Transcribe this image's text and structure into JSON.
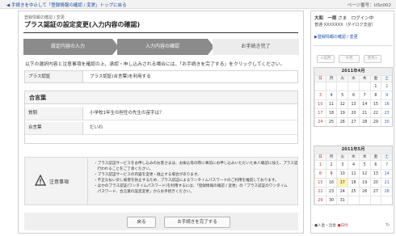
{
  "topbar": {
    "back_link": "◀ 手続きを中止して「登録情報の確認 / 変更」トップに戻る",
    "page_number": "ページ番号：USo002"
  },
  "main": {
    "breadcrumb": "登録情報の確認 / 変更",
    "title": "プラス認証の設定変更(入力内容の確認)",
    "steps": [
      "設定内容の入力",
      "入力内容の確認",
      "お手続き完了"
    ],
    "intro": "以下の選択内容と注意事項を確認の上、承認・申し込みされる場合には、「お手続きを完了する」をクリックしてください。",
    "summary": {
      "label": "プラス認証",
      "value": "プラス認証(合言葉)を利用する"
    },
    "passphrase": {
      "heading": "合言葉",
      "rows": [
        {
          "label": "質問",
          "value": "小学校1年生の担任の先生の苗字は？"
        },
        {
          "label": "合言葉",
          "value": "だいわ"
        }
      ]
    },
    "notice": {
      "label": "注意事項",
      "items": [
        "・プラス認証サービスをお申し込みのお客さまは、お振込等の際に事前にお申し込みいただいた本人確認に加え、プラス認証による本人確認が",
        "　行われることをご了承ください。",
        "・プラス認証サービスの内容を変更・廃止する場合があります。",
        "・不正な払い戻し被害を防止するため、プラス認証によるワンタイムパスワードのご利用を推奨しております。",
        "・ほかのプラス認証(ワンタイムパスワード)を利用するには、「登録情報の確認 / 変更」の「プラス認証のワンタイム",
        "　パスワード、合言葉の設定変更」からお手続きください。"
      ]
    },
    "buttons": {
      "back": "戻る",
      "complete": "お手続きを完了する"
    }
  },
  "side": {
    "user_name": "大和　一郎",
    "user_suffix": " さま　ログイン中",
    "account": "普通 XXXXXXX（ダイロク支店）",
    "link": "▶登録情報の確認 / 変更",
    "nav": {
      "prev": "<前月",
      "today": "今月",
      "next": "翌月>"
    },
    "weekdays": [
      "日",
      "月",
      "火",
      "水",
      "木",
      "金",
      "土"
    ],
    "calendars": [
      {
        "title": "2011年4月",
        "days": [
          "",
          "",
          "",
          "",
          "",
          "1",
          "2",
          "3",
          "4",
          "5",
          "6",
          "7",
          "8",
          "9",
          "10",
          "11",
          "12",
          "13",
          "14",
          "15",
          "16",
          "17",
          "18",
          "19",
          "20",
          "21",
          "22",
          "23",
          "24",
          "25",
          "26",
          "27",
          "28",
          "29",
          "30"
        ]
      },
      {
        "title": "2011年5月",
        "days": [
          "1",
          "2",
          "3",
          "4",
          "5",
          "6",
          "7",
          "8",
          "9",
          "10",
          "11",
          "12",
          "13",
          "14",
          "15",
          "16",
          "17",
          "18",
          "19",
          "20",
          "21",
          "22",
          "23",
          "24",
          "25",
          "26",
          "27",
          "28",
          "29",
          "30",
          "31",
          "",
          "",
          "",
          ""
        ]
      }
    ],
    "highlight_day": "17",
    "legend_a": "●入金・出金",
    "legend_b": "●日付",
    "refresh_icon": "refresh-icon"
  }
}
